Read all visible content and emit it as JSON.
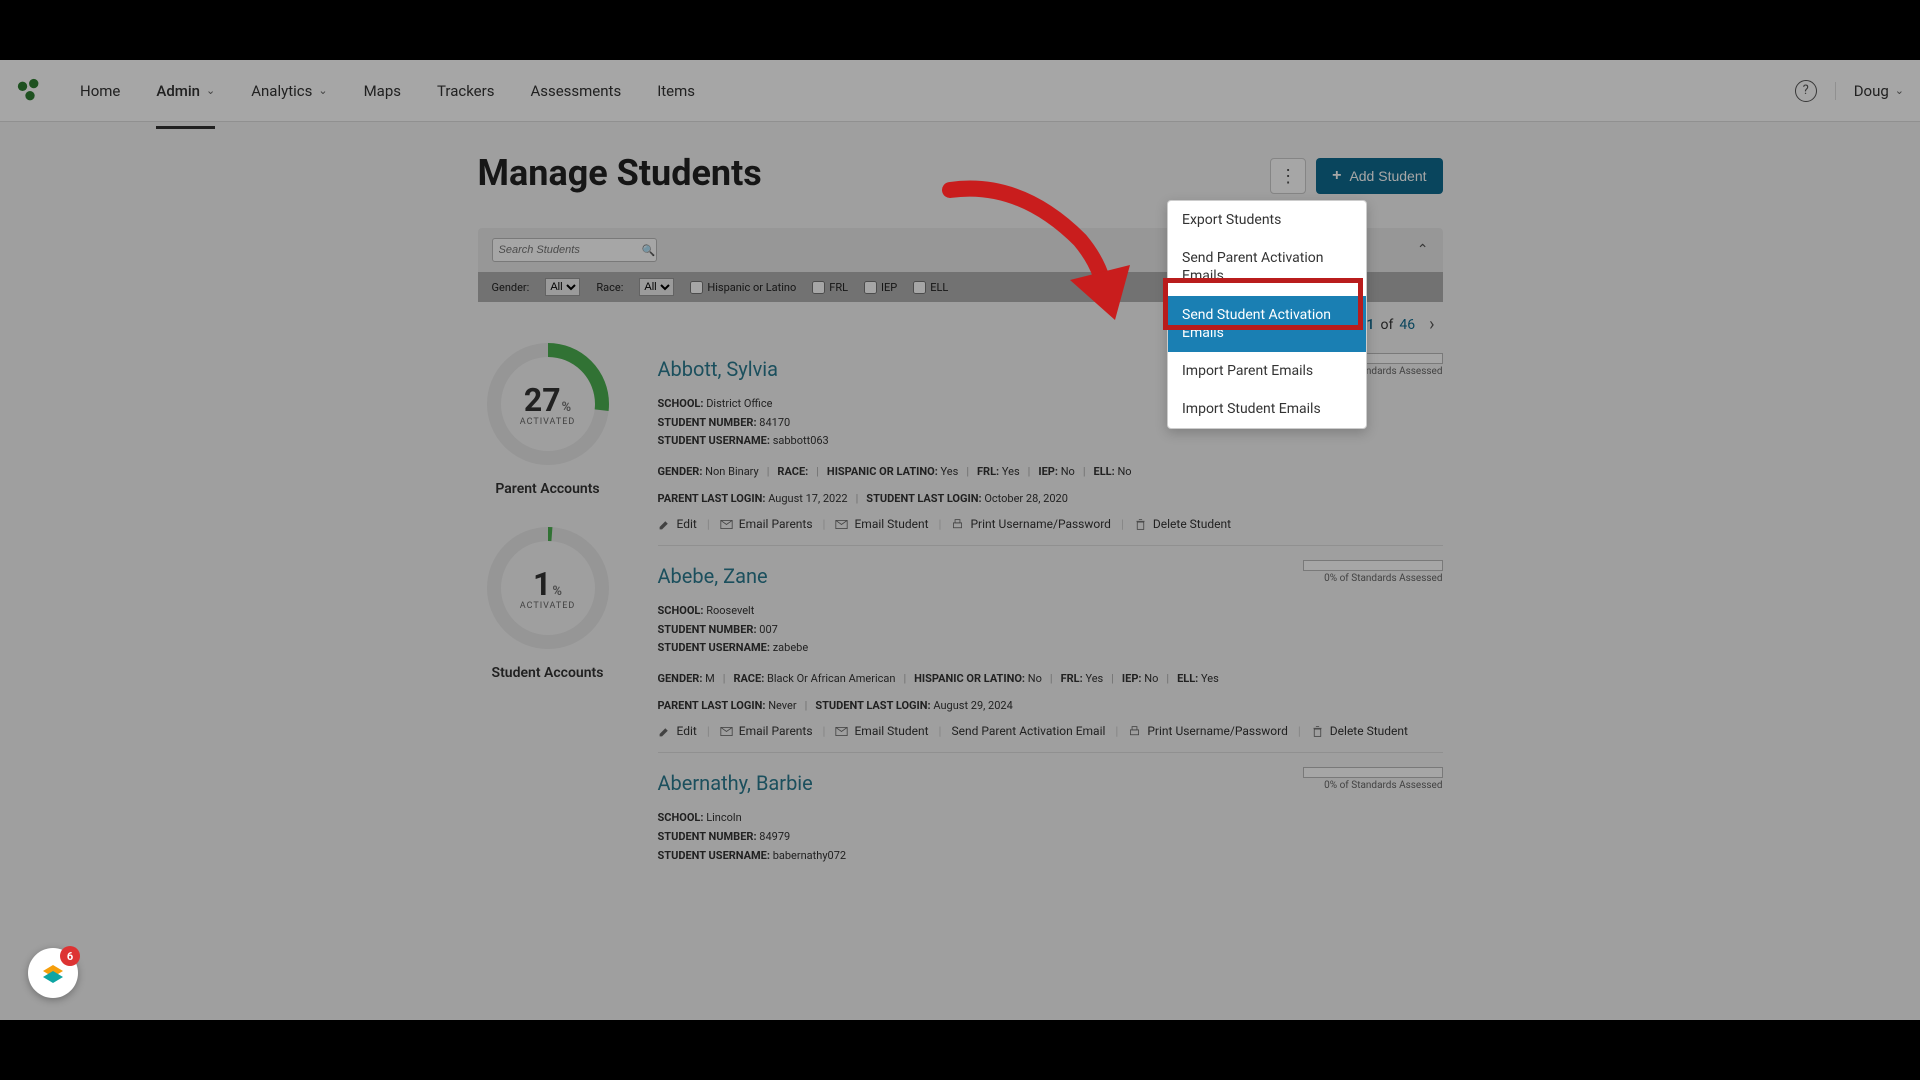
{
  "nav": {
    "items": [
      "Home",
      "Admin",
      "Analytics",
      "Maps",
      "Trackers",
      "Assessments",
      "Items"
    ],
    "user": "Doug"
  },
  "page": {
    "title": "Manage Students",
    "add_button": "Add Student",
    "search_placeholder": "Search Students"
  },
  "filters": {
    "gender_label": "Gender:",
    "gender_value": "All",
    "race_label": "Race:",
    "race_value": "All",
    "hispanic": "Hispanic or Latino",
    "frl": "FRL",
    "iep": "IEP",
    "ell": "ELL"
  },
  "pagination": {
    "current": "1",
    "total": "46"
  },
  "donuts": {
    "parent": {
      "value": "27",
      "sub": "ACTIVATED",
      "label": "Parent Accounts",
      "pct": 27
    },
    "student": {
      "value": "1",
      "sub": "ACTIVATED",
      "label": "Student Accounts",
      "pct": 1
    }
  },
  "labels": {
    "school": "SCHOOL:",
    "student_number": "STUDENT NUMBER:",
    "student_username": "STUDENT USERNAME:",
    "gender": "GENDER:",
    "race": "RACE:",
    "hispanic": "HISPANIC OR LATINO:",
    "frl": "FRL:",
    "iep": "IEP:",
    "ell": "ELL:",
    "parent_last_login": "PARENT LAST LOGIN:",
    "student_last_login": "STUDENT LAST LOGIN:",
    "standards": "0% of Standards Assessed"
  },
  "actions": {
    "edit": "Edit",
    "email_parents": "Email Parents",
    "email_student": "Email Student",
    "print": "Print Username/Password",
    "delete": "Delete Student",
    "send_parent_activation": "Send Parent Activation Email"
  },
  "students": [
    {
      "name": "Abbott, Sylvia",
      "school": "District Office",
      "number": "84170",
      "username": "sabbott063",
      "gender": "Non Binary",
      "race": "",
      "hispanic": "Yes",
      "frl": "Yes",
      "iep": "No",
      "ell": "No",
      "parent_login": "August 17, 2022",
      "student_login": "October 28, 2020"
    },
    {
      "name": "Abebe, Zane",
      "school": "Roosevelt",
      "number": "007",
      "username": "zabebe",
      "gender": "M",
      "race": "Black Or African American",
      "hispanic": "No",
      "frl": "Yes",
      "iep": "No",
      "ell": "Yes",
      "parent_login": "Never",
      "student_login": "August 29, 2024"
    },
    {
      "name": "Abernathy, Barbie",
      "school": "Lincoln",
      "number": "84979",
      "username": "babernathy072",
      "gender": "",
      "race": "",
      "hispanic": "",
      "frl": "",
      "iep": "",
      "ell": "",
      "parent_login": "",
      "student_login": ""
    }
  ],
  "dropdown": {
    "items": [
      "Export Students",
      "Send Parent Activation Emails",
      "Send Student Activation Emails",
      "Import Parent Emails",
      "Import Student Emails"
    ]
  },
  "widget": {
    "badge": "6"
  }
}
